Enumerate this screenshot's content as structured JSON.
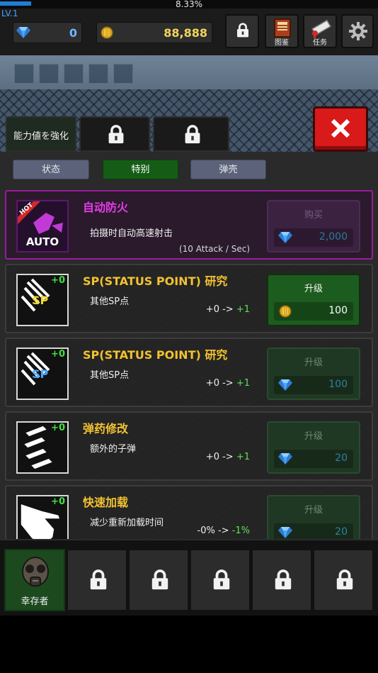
{
  "top": {
    "xp_percent_text": "8.33%",
    "xp_fraction": 0.0833,
    "level": "LV.1",
    "gems": "0",
    "gold": "88,888",
    "buttons": [
      {
        "icon": "lock-icon",
        "label": ""
      },
      {
        "icon": "book-icon",
        "label": "图鉴"
      },
      {
        "icon": "scroll-icon",
        "label": "任务"
      },
      {
        "icon": "gear-icon",
        "label": ""
      }
    ]
  },
  "banner": {
    "tabs": [
      {
        "label": "能力値を強化",
        "locked": false
      },
      {
        "label": "",
        "locked": true
      },
      {
        "label": "",
        "locked": true
      }
    ],
    "close_icon": "close-icon"
  },
  "subtabs": [
    {
      "label": "状态",
      "active": false
    },
    {
      "label": "特别",
      "active": true
    },
    {
      "label": "弹壳",
      "active": false
    }
  ],
  "items": [
    {
      "icon": "auto-fire-icon",
      "badge": "HOT",
      "icon_text": "AUTO",
      "title": "自动防火",
      "desc": "拍摄时自动高速射击",
      "change_prefix": "(10 Attack / Sec)",
      "change_new": "",
      "button": "购买",
      "currency": "gem-icon",
      "price": "2,000",
      "plus": ""
    },
    {
      "icon": "sp-icon",
      "icon_text": "SP",
      "plus": "+0",
      "title": "SP(STATUS POINT) 研究",
      "desc": "其他SP点",
      "change_prefix": "+0 ->",
      "change_new": "+1",
      "button": "升级",
      "currency": "coin-icon",
      "price": "100"
    },
    {
      "icon": "sp-icon",
      "icon_text": "SP",
      "plus": "+0",
      "title": "SP(STATUS POINT) 研究",
      "desc": "其他SP点",
      "change_prefix": "+0 ->",
      "change_new": "+1",
      "button": "升级",
      "currency": "gem-icon",
      "price": "100"
    },
    {
      "icon": "bullets-icon",
      "icon_text": "",
      "plus": "+0",
      "title": "弹药修改",
      "desc": "额外的子弹",
      "change_prefix": "+0 ->",
      "change_new": "+1",
      "button": "升级",
      "currency": "gem-icon",
      "price": "20"
    },
    {
      "icon": "hand-icon",
      "icon_text": "",
      "plus": "+0",
      "title": "快速加载",
      "desc": "减少重新加载时间",
      "change_prefix": "-0% ->",
      "change_new": "-1%",
      "button": "升级",
      "currency": "gem-icon",
      "price": "20"
    }
  ],
  "characters": [
    {
      "label": "幸存者",
      "icon": "gas-mask-icon",
      "locked": false
    },
    {
      "label": "",
      "icon": "lock-icon",
      "locked": true
    },
    {
      "label": "",
      "icon": "lock-icon",
      "locked": true
    },
    {
      "label": "",
      "icon": "lock-icon",
      "locked": true
    },
    {
      "label": "",
      "icon": "lock-icon",
      "locked": true
    },
    {
      "label": "",
      "icon": "lock-icon",
      "locked": true
    }
  ]
}
